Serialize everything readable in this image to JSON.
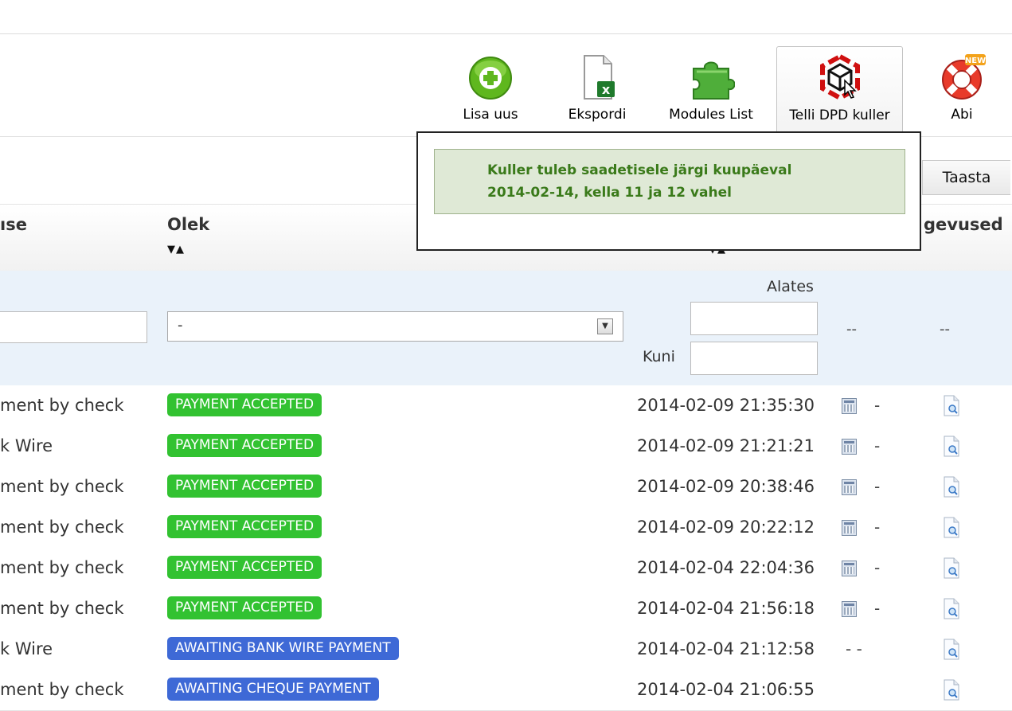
{
  "toolbar": {
    "buttons": [
      {
        "label": "Lisa uus",
        "icon": "add-icon"
      },
      {
        "label": "Ekspordi",
        "icon": "excel-export-icon"
      },
      {
        "label": "Modules List",
        "icon": "puzzle-piece-icon"
      },
      {
        "label": "Telli DPD kuller",
        "icon": "dpd-box-icon"
      },
      {
        "label": "Abi",
        "icon": "lifebuoy-icon",
        "badge": "NEW"
      }
    ]
  },
  "popup": {
    "line1": "Kuller tuleb saadetisele järgi kuupäeval",
    "line2": "2014-02-14, kella 11 ja 12 vahel"
  },
  "list": {
    "reset_button": "Taasta",
    "columns": {
      "payment": "ıse",
      "status": "Olek",
      "actions": "gevused",
      "sort_arrows": "▼▲"
    },
    "filters": {
      "status_selected": "-",
      "from_label": "Alates",
      "to_label": "Kuni",
      "dash1": "--",
      "dash2": "--"
    },
    "rows": [
      {
        "payment": "ment by check",
        "status": "PAYMENT ACCEPTED",
        "status_color": "#32c231",
        "date": "2014-02-09 21:35:30",
        "invoice": "calendar",
        "extra": "-"
      },
      {
        "payment": "k Wire",
        "status": "PAYMENT ACCEPTED",
        "status_color": "#32c231",
        "date": "2014-02-09 21:21:21",
        "invoice": "calendar",
        "extra": "-"
      },
      {
        "payment": "ment by check",
        "status": "PAYMENT ACCEPTED",
        "status_color": "#32c231",
        "date": "2014-02-09 20:38:46",
        "invoice": "calendar",
        "extra": "-"
      },
      {
        "payment": "ment by check",
        "status": "PAYMENT ACCEPTED",
        "status_color": "#32c231",
        "date": "2014-02-09 20:22:12",
        "invoice": "calendar",
        "extra": "-"
      },
      {
        "payment": "ment by check",
        "status": "PAYMENT ACCEPTED",
        "status_color": "#32c231",
        "date": "2014-02-04 22:04:36",
        "invoice": "calendar",
        "extra": "-"
      },
      {
        "payment": "ment by check",
        "status": "PAYMENT ACCEPTED",
        "status_color": "#32c231",
        "date": "2014-02-04 21:56:18",
        "invoice": "calendar",
        "extra": "-"
      },
      {
        "payment": "k Wire",
        "status": "AWAITING BANK WIRE PAYMENT",
        "status_color": "#3e69d6",
        "date": "2014-02-04 21:12:58",
        "invoice": "none",
        "extra": "- -"
      },
      {
        "payment": "ment by check",
        "status": "AWAITING CHEQUE PAYMENT",
        "status_color": "#3e69d6",
        "date": "2014-02-04 21:06:55",
        "invoice": "none",
        "extra": ""
      }
    ]
  }
}
